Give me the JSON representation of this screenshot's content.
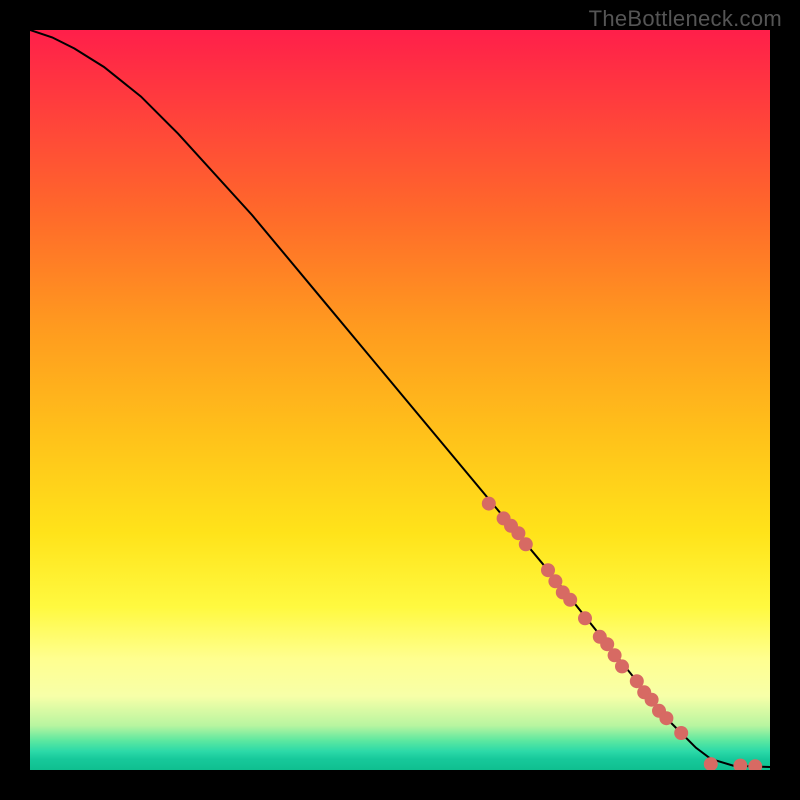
{
  "watermark": "TheBottleneck.com",
  "chart_data": {
    "type": "line",
    "title": "",
    "xlabel": "",
    "ylabel": "",
    "xlim": [
      0,
      100
    ],
    "ylim": [
      0,
      100
    ],
    "curve": {
      "name": "bottleneck-curve",
      "x": [
        0,
        3,
        6,
        10,
        15,
        20,
        30,
        40,
        50,
        60,
        70,
        78,
        82,
        85,
        88,
        90,
        92,
        95,
        100
      ],
      "y": [
        100,
        99,
        97.5,
        95,
        91,
        86,
        75,
        63,
        51,
        39,
        27,
        17,
        12,
        8,
        5,
        3,
        1.5,
        0.6,
        0.4
      ]
    },
    "scatter_on_curve": {
      "name": "markers",
      "color": "#d76a63",
      "radius": 7,
      "x": [
        62,
        64,
        65,
        66,
        67,
        70,
        71,
        72,
        73,
        75,
        77,
        78,
        79,
        80,
        82,
        83,
        84,
        85,
        86,
        88,
        92,
        96,
        98
      ],
      "y": [
        36,
        34,
        33,
        32,
        30.5,
        27,
        25.5,
        24,
        23,
        20.5,
        18,
        17,
        15.5,
        14,
        12,
        10.5,
        9.5,
        8,
        7,
        5,
        0.8,
        0.6,
        0.5
      ]
    }
  }
}
